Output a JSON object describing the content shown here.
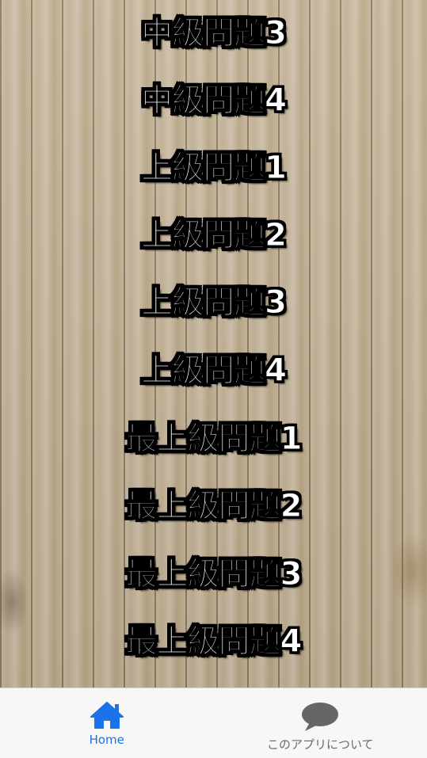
{
  "menu": {
    "items": [
      {
        "label": "中級問題3"
      },
      {
        "label": "中級問題4"
      },
      {
        "label": "上級問題1"
      },
      {
        "label": "上級問題2"
      },
      {
        "label": "上級問題3"
      },
      {
        "label": "上級問題4"
      },
      {
        "label": "最上級問題1"
      },
      {
        "label": "最上級問題2"
      },
      {
        "label": "最上級問題3"
      },
      {
        "label": "最上級問題4"
      }
    ]
  },
  "tabbar": {
    "home": {
      "label": "Home",
      "icon": "home-icon",
      "color": "#1a73e8",
      "active": true
    },
    "about": {
      "label": "このアプリについて",
      "icon": "speech-bubble-icon",
      "color": "#6b6b6b",
      "active": false
    }
  },
  "background": {
    "theme": "wood-planks"
  }
}
